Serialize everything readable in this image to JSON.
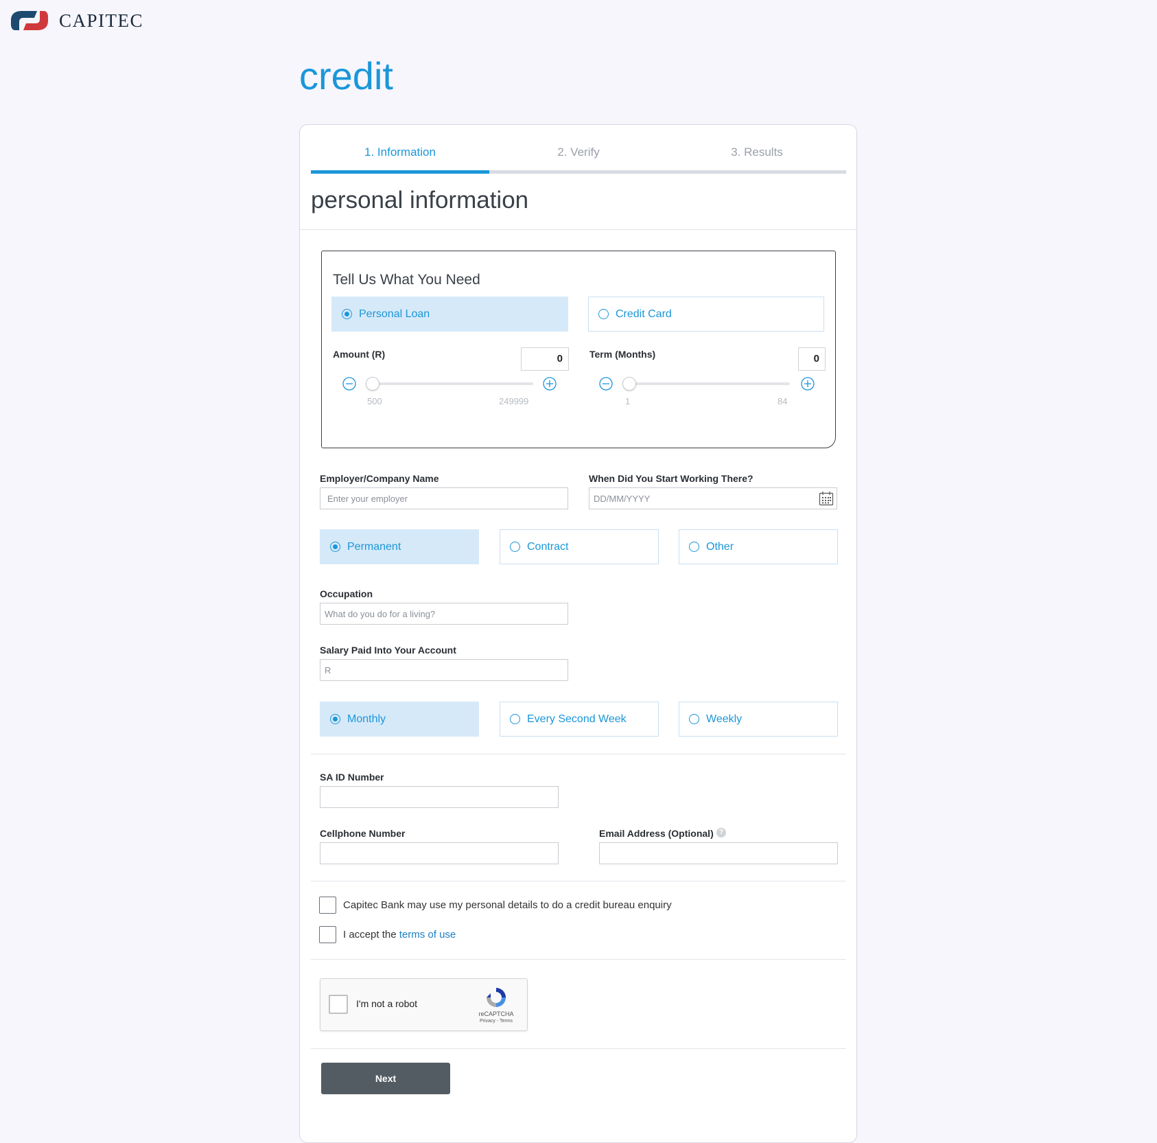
{
  "brand": {
    "name": "CAPITEC"
  },
  "page": {
    "title": "credit"
  },
  "steps": [
    "1. Information",
    "2. Verify",
    "3. Results"
  ],
  "steps_progress_fraction": 0.333,
  "section": {
    "title": "personal information"
  },
  "need": {
    "title": "Tell Us What You Need",
    "products": [
      {
        "label": "Personal Loan",
        "selected": true
      },
      {
        "label": "Credit Card",
        "selected": false
      }
    ],
    "amount": {
      "label": "Amount (R)",
      "value": "0",
      "min": "500",
      "max": "249999"
    },
    "term": {
      "label": "Term (Months)",
      "value": "0",
      "min": "1",
      "max": "84"
    }
  },
  "employer": {
    "label": "Employer/Company Name",
    "placeholder": "Enter your employer",
    "value": ""
  },
  "start_date": {
    "label": "When Did You Start Working There?",
    "placeholder": "DD/MM/YYYY",
    "value": ""
  },
  "employment_types": [
    {
      "label": "Permanent",
      "selected": true
    },
    {
      "label": "Contract",
      "selected": false
    },
    {
      "label": "Other",
      "selected": false
    }
  ],
  "occupation": {
    "label": "Occupation",
    "placeholder": "What do you do for a living?",
    "value": ""
  },
  "salary": {
    "label": "Salary Paid Into Your Account",
    "placeholder": "R",
    "value": ""
  },
  "pay_frequency": [
    {
      "label": "Monthly",
      "selected": true
    },
    {
      "label": "Every Second Week",
      "selected": false
    },
    {
      "label": "Weekly",
      "selected": false
    }
  ],
  "id_number": {
    "label": "SA ID Number",
    "value": ""
  },
  "cellphone": {
    "label": "Cellphone Number",
    "value": ""
  },
  "email": {
    "label": "Email Address (Optional)",
    "value": "",
    "help": "?"
  },
  "consent": {
    "bureau": "Capitec Bank may use my personal details to do a credit bureau enquiry",
    "terms_prefix": "I accept the",
    "terms_link": "terms of use"
  },
  "captcha": {
    "label": "I'm not a robot",
    "brand": "reCAPTCHA",
    "links": "Privacy - Terms"
  },
  "next_button": "Next",
  "colors": {
    "accent": "#1b96d8",
    "selected_bg": "#d6e9f8",
    "button": "#545c63",
    "brand_red": "#d0393c",
    "brand_navy": "#1d4a6e"
  }
}
